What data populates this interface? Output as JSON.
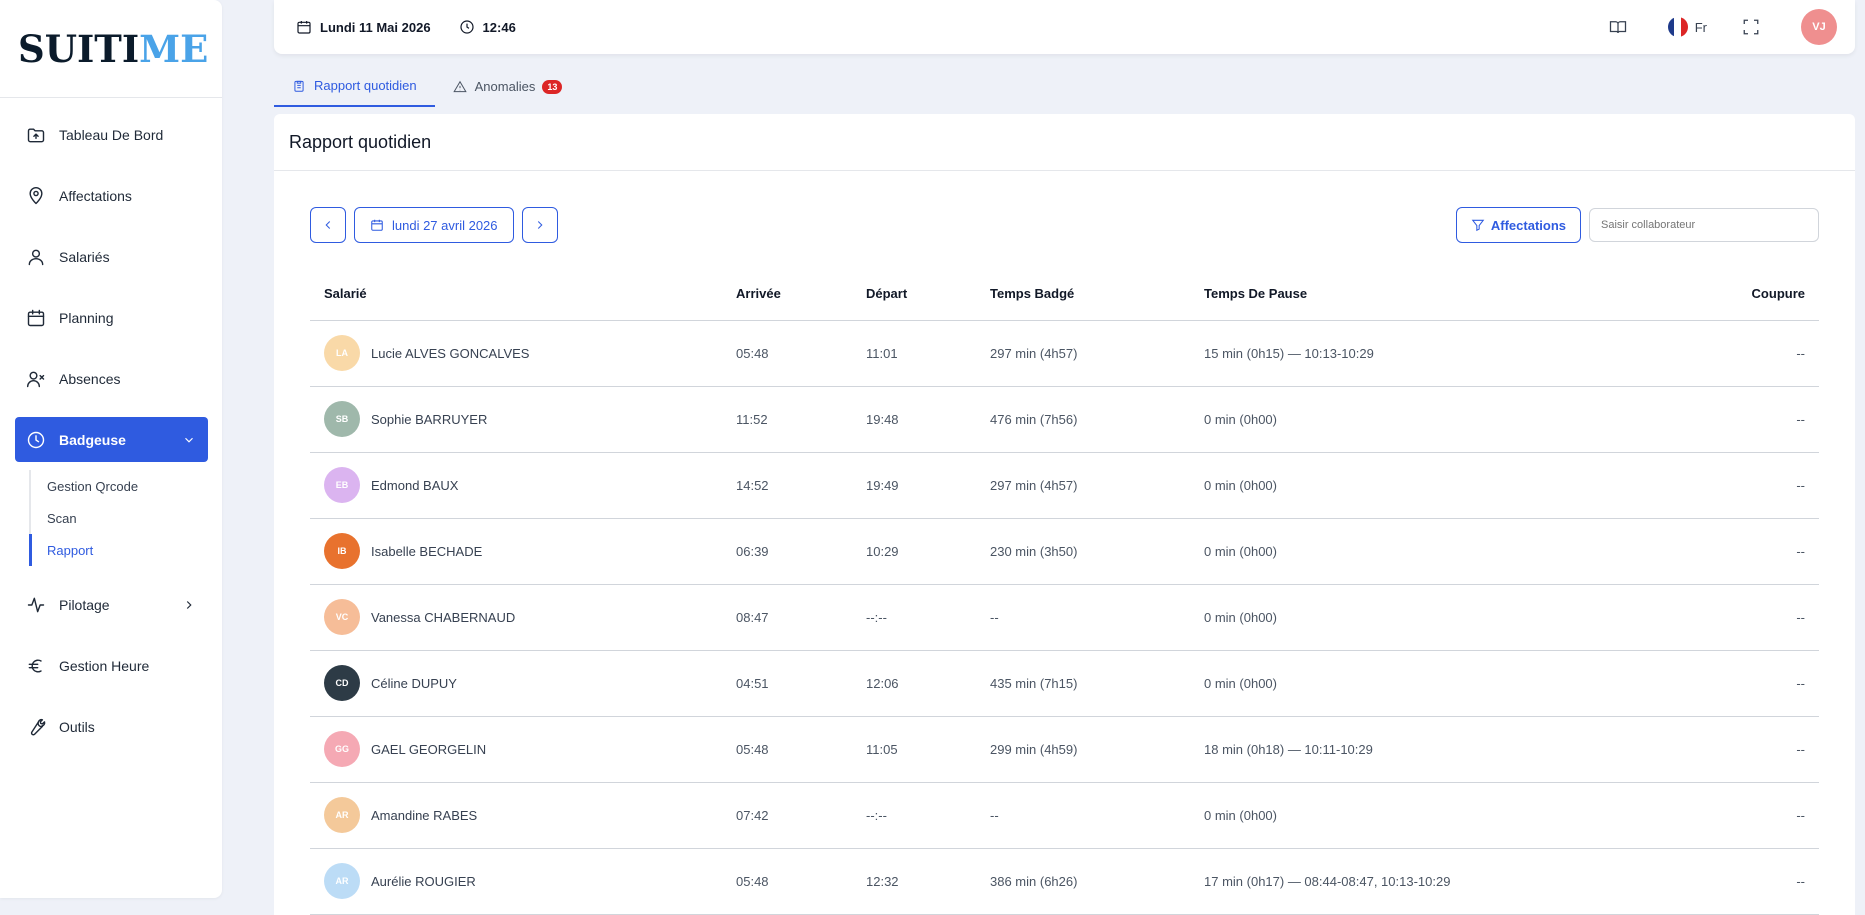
{
  "logo": {
    "part1": "SUIT",
    "part2": "I",
    "part3": "ME"
  },
  "sidebar": {
    "items": [
      {
        "label": "Tableau De Bord",
        "icon": "folder-upload-icon"
      },
      {
        "label": "Affectations",
        "icon": "map-pin-icon"
      },
      {
        "label": "Salariés",
        "icon": "user-icon"
      },
      {
        "label": "Planning",
        "icon": "calendar-icon"
      },
      {
        "label": "Absences",
        "icon": "user-x-icon"
      },
      {
        "label": "Badgeuse",
        "icon": "clock-icon"
      },
      {
        "label": "Pilotage",
        "icon": "activity-icon"
      },
      {
        "label": "Gestion Heure",
        "icon": "euro-icon"
      },
      {
        "label": "Outils",
        "icon": "wrench-icon"
      }
    ],
    "sub_items": [
      {
        "label": "Gestion Qrcode"
      },
      {
        "label": "Scan"
      },
      {
        "label": "Rapport"
      }
    ]
  },
  "header": {
    "date": "Lundi 11 Mai 2026",
    "time": "12:46",
    "lang": "Fr",
    "avatar": "VJ"
  },
  "tabs": [
    {
      "label": "Rapport quotidien"
    },
    {
      "label": "Anomalies",
      "badge": "13"
    }
  ],
  "main": {
    "title": "Rapport quotidien",
    "date_label": "lundi 27 avril 2026",
    "filter_label": "Affectations",
    "search_placeholder": "Saisir collaborateur"
  },
  "table": {
    "headers": [
      "Salarié",
      "Arrivée",
      "Départ",
      "Temps Badgé",
      "Temps De Pause",
      "Coupure"
    ],
    "rows": [
      {
        "initials": "LA",
        "color": "#f9d9a8",
        "name": "Lucie ALVES GONCALVES",
        "arrivee": "05:48",
        "depart": "11:01",
        "badge": "297 min (4h57)",
        "pause": "15 min (0h15) — 10:13-10:29",
        "coupure": "--"
      },
      {
        "initials": "SB",
        "color": "#9fb8ab",
        "name": "Sophie BARRUYER",
        "arrivee": "11:52",
        "depart": "19:48",
        "badge": "476 min (7h56)",
        "pause": "0 min (0h00)",
        "coupure": "--"
      },
      {
        "initials": "EB",
        "color": "#dbb4f0",
        "name": "Edmond BAUX",
        "arrivee": "14:52",
        "depart": "19:49",
        "badge": "297 min (4h57)",
        "pause": "0 min (0h00)",
        "coupure": "--"
      },
      {
        "initials": "IB",
        "color": "#e8722e",
        "name": "Isabelle BECHADE",
        "arrivee": "06:39",
        "depart": "10:29",
        "badge": "230 min (3h50)",
        "pause": "0 min (0h00)",
        "coupure": "--"
      },
      {
        "initials": "VC",
        "color": "#f6bd98",
        "name": "Vanessa CHABERNAUD",
        "arrivee": "08:47",
        "depart": "--:--",
        "badge": "--",
        "pause": "0 min (0h00)",
        "coupure": "--"
      },
      {
        "initials": "CD",
        "color": "#2d3b46",
        "name": "Céline DUPUY",
        "arrivee": "04:51",
        "depart": "12:06",
        "badge": "435 min (7h15)",
        "pause": "0 min (0h00)",
        "coupure": "--"
      },
      {
        "initials": "GG",
        "color": "#f5a9b4",
        "name": "GAEL GEORGELIN",
        "arrivee": "05:48",
        "depart": "11:05",
        "badge": "299 min (4h59)",
        "pause": "18 min (0h18) — 10:11-10:29",
        "coupure": "--"
      },
      {
        "initials": "AR",
        "color": "#f4c99a",
        "name": "Amandine RABES",
        "arrivee": "07:42",
        "depart": "--:--",
        "badge": "--",
        "pause": "0 min (0h00)",
        "coupure": "--"
      },
      {
        "initials": "AR",
        "color": "#bcdcf6",
        "name": "Aurélie ROUGIER",
        "arrivee": "05:48",
        "depart": "12:32",
        "badge": "386 min (6h26)",
        "pause": "17 min (0h17) — 08:44-08:47, 10:13-10:29",
        "coupure": "--"
      }
    ]
  },
  "colors": {
    "accent": "#2f5be0",
    "danger": "#dc2626",
    "background": "#eef1f8"
  }
}
